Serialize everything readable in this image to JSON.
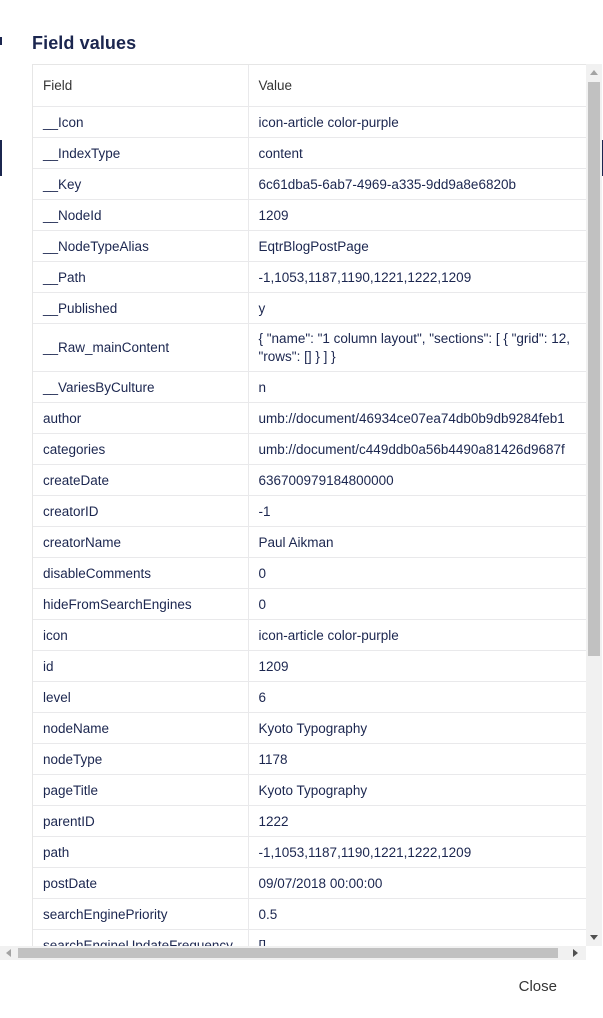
{
  "dialog": {
    "title": "Field values",
    "close_label": "Close"
  },
  "table": {
    "headers": {
      "field": "Field",
      "value": "Value"
    },
    "rows": [
      {
        "field": "__Icon",
        "value": "icon-article color-purple"
      },
      {
        "field": "__IndexType",
        "value": "content"
      },
      {
        "field": "__Key",
        "value": "6c61dba5-6ab7-4969-a335-9dd9a8e6820b"
      },
      {
        "field": "__NodeId",
        "value": "1209"
      },
      {
        "field": "__NodeTypeAlias",
        "value": "EqtrBlogPostPage"
      },
      {
        "field": "__Path",
        "value": "-1,1053,1187,1190,1221,1222,1209"
      },
      {
        "field": "__Published",
        "value": "y"
      },
      {
        "field": "__Raw_mainContent",
        "value": "{ \"name\": \"1 column layout\", \"sections\": [ { \"grid\": 12, \"rows\": [] } ] }"
      },
      {
        "field": "__VariesByCulture",
        "value": "n"
      },
      {
        "field": "author",
        "value": "umb://document/46934ce07ea74db0b9db9284feb1"
      },
      {
        "field": "categories",
        "value": "umb://document/c449ddb0a56b4490a81426d9687f"
      },
      {
        "field": "createDate",
        "value": "636700979184800000"
      },
      {
        "field": "creatorID",
        "value": "-1"
      },
      {
        "field": "creatorName",
        "value": "Paul Aikman"
      },
      {
        "field": "disableComments",
        "value": "0"
      },
      {
        "field": "hideFromSearchEngines",
        "value": "0"
      },
      {
        "field": "icon",
        "value": "icon-article color-purple"
      },
      {
        "field": "id",
        "value": "1209"
      },
      {
        "field": "level",
        "value": "6"
      },
      {
        "field": "nodeName",
        "value": "Kyoto Typography"
      },
      {
        "field": "nodeType",
        "value": "1178"
      },
      {
        "field": "pageTitle",
        "value": "Kyoto Typography"
      },
      {
        "field": "parentID",
        "value": "1222"
      },
      {
        "field": "path",
        "value": "-1,1053,1187,1190,1221,1222,1209"
      },
      {
        "field": "postDate",
        "value": "09/07/2018 00:00:00"
      },
      {
        "field": "searchEnginePriority",
        "value": "0.5"
      },
      {
        "field": "searchEngineUpdateFrequency",
        "value": "[]"
      }
    ]
  },
  "colors": {
    "text": "#1b264f",
    "border": "#e9e9eb",
    "scroll_thumb": "#c1c1c1",
    "scroll_track": "#f1f1f1"
  },
  "icons": {
    "scroll_up": "arrow-up-icon",
    "scroll_down": "arrow-down-icon",
    "scroll_left": "arrow-left-icon",
    "scroll_right": "arrow-right-icon"
  }
}
